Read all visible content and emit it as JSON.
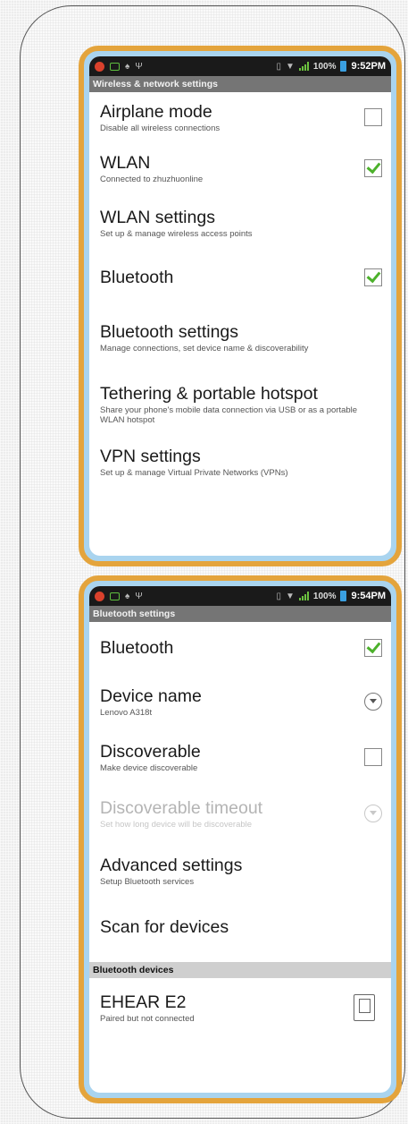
{
  "screen1": {
    "status_bar": {
      "battery": "100%",
      "time": "9:52PM"
    },
    "header": "Wireless & network settings",
    "rows": [
      {
        "title": "Airplane mode",
        "subtitle": "Disable all wireless connections",
        "control": "checkbox",
        "checked": false
      },
      {
        "title": "WLAN",
        "subtitle": "Connected to zhuzhuonline",
        "control": "checkbox",
        "checked": true
      },
      {
        "title": "WLAN settings",
        "subtitle": "Set up & manage wireless access points",
        "control": "none"
      },
      {
        "title": "Bluetooth",
        "subtitle": "",
        "control": "checkbox",
        "checked": true
      },
      {
        "title": "Bluetooth settings",
        "subtitle": "Manage connections, set device name & discoverability",
        "control": "none"
      },
      {
        "title": "Tethering & portable hotspot",
        "subtitle": "Share your phone's mobile data connection via USB or as a portable WLAN hotspot",
        "control": "none"
      },
      {
        "title": "VPN settings",
        "subtitle": "Set up & manage Virtual Private Networks (VPNs)",
        "control": "none"
      }
    ]
  },
  "screen2": {
    "status_bar": {
      "battery": "100%",
      "time": "9:54PM"
    },
    "header": "Bluetooth settings",
    "rows": [
      {
        "title": "Bluetooth",
        "subtitle": "",
        "control": "checkbox",
        "checked": true
      },
      {
        "title": "Device name",
        "subtitle": "Lenovo A318t",
        "control": "dropdown"
      },
      {
        "title": "Discoverable",
        "subtitle": "Make device discoverable",
        "control": "checkbox",
        "checked": false
      },
      {
        "title": "Discoverable timeout",
        "subtitle": "Set how long device will be discoverable",
        "control": "dropdown",
        "disabled": true
      },
      {
        "title": "Advanced settings",
        "subtitle": "Setup Bluetooth services",
        "control": "none"
      },
      {
        "title": "Scan for devices",
        "subtitle": "",
        "control": "none"
      }
    ],
    "devices_header": "Bluetooth devices",
    "device": {
      "title": "EHEAR E2",
      "subtitle": "Paired but not connected"
    }
  },
  "colors": {
    "frame": "#e4a43c",
    "inner_frame": "#a9d4ef",
    "check": "#4cb12b",
    "status_bar": "#1a1a1a",
    "header": "#757575"
  }
}
